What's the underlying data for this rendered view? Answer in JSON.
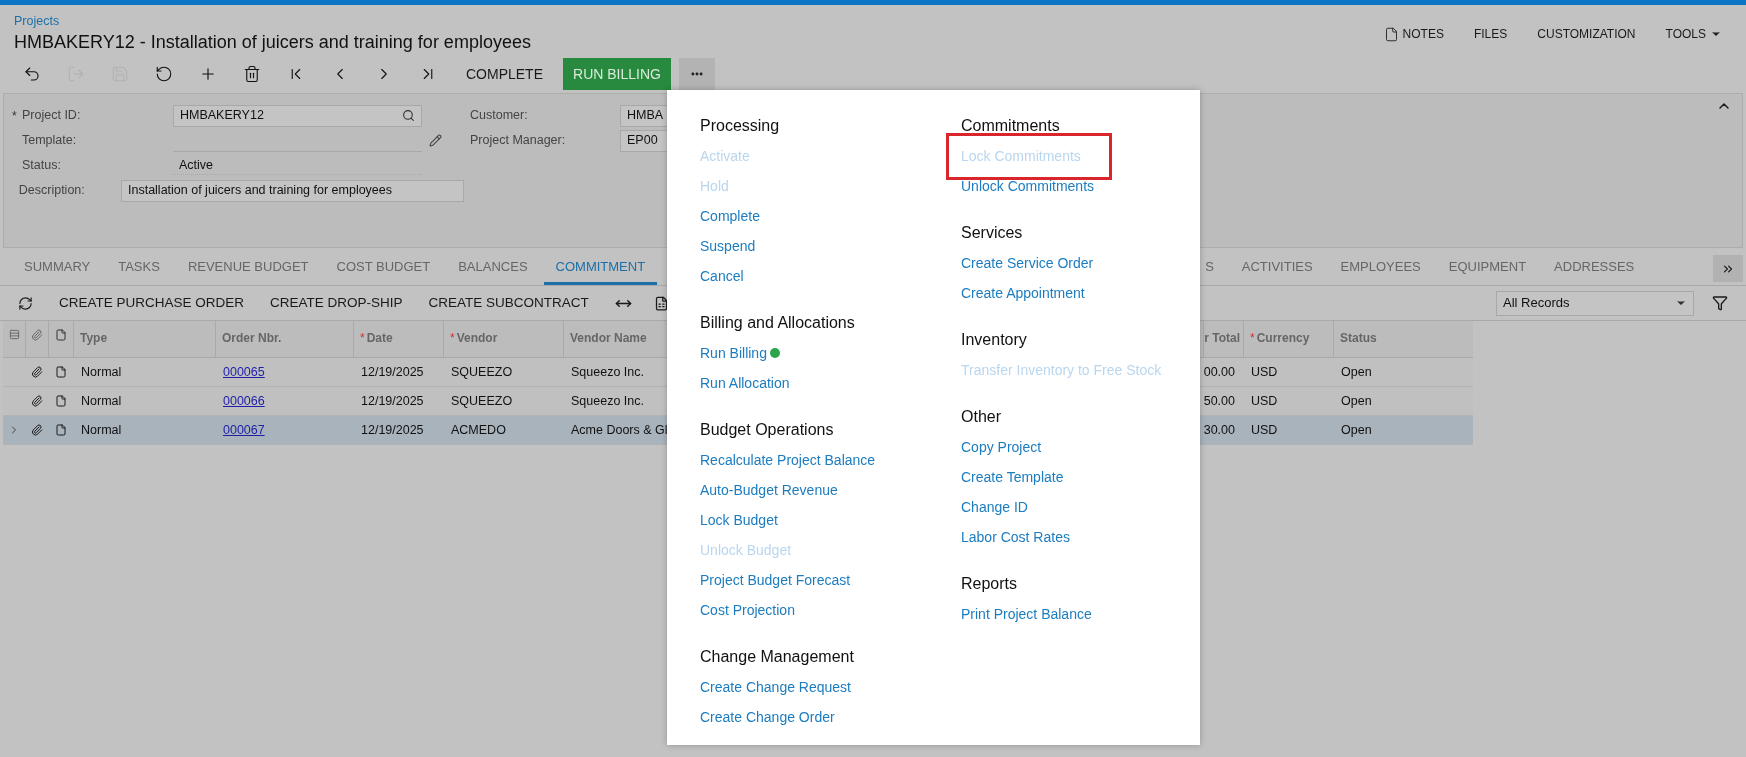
{
  "breadcrumb": "Projects",
  "title": "HMBAKERY12 - Installation of juicers and training for employees",
  "top_actions": [
    {
      "label": "NOTES",
      "kind": "notes"
    },
    {
      "label": "FILES",
      "kind": "plain"
    },
    {
      "label": "CUSTOMIZATION",
      "kind": "plain"
    },
    {
      "label": "TOOLS",
      "kind": "dropdown"
    }
  ],
  "icon_buttons": [
    {
      "kind": "back",
      "disabled": false
    },
    {
      "kind": "save-close",
      "disabled": true
    },
    {
      "kind": "save",
      "disabled": true
    },
    {
      "kind": "undo",
      "disabled": false
    },
    {
      "kind": "add",
      "disabled": false
    },
    {
      "kind": "delete",
      "disabled": false
    },
    {
      "kind": "first",
      "disabled": false
    },
    {
      "kind": "previous",
      "disabled": false
    },
    {
      "kind": "next",
      "disabled": false
    },
    {
      "kind": "last",
      "disabled": false
    }
  ],
  "action_buttons": [
    {
      "label": "COMPLETE",
      "kind": "plain"
    },
    {
      "label": "RUN BILLING",
      "kind": "primary"
    }
  ],
  "form": {
    "fields": [
      {
        "mark": "*",
        "label": "Project ID:",
        "value": "HMBAKERY12",
        "kind": "lookup"
      },
      {
        "label": "Template:",
        "kind": "editable"
      },
      {
        "label": "Status:",
        "value": "Active",
        "kind": "readonly"
      },
      {
        "label": "Description:",
        "value": "Installation of juicers and training for employees",
        "kind": "wide"
      }
    ],
    "side_fields": [
      {
        "label": "Customer:",
        "value": "HMBA"
      },
      {
        "label": "Project Manager:",
        "value": "EP00"
      }
    ]
  },
  "tabs": [
    {
      "label": "SUMMARY",
      "selected": false
    },
    {
      "label": "TASKS",
      "selected": false
    },
    {
      "label": "REVENUE BUDGET",
      "selected": false
    },
    {
      "label": "COST BUDGET",
      "selected": false
    },
    {
      "label": "BALANCES",
      "selected": false
    },
    {
      "label": "COMMITMENT",
      "selected": true
    }
  ],
  "tabs_right": [
    {
      "label": "S",
      "selected": false
    },
    {
      "label": "ACTIVITIES",
      "selected": false
    },
    {
      "label": "EMPLOYEES",
      "selected": false
    },
    {
      "label": "EQUIPMENT",
      "selected": false
    },
    {
      "label": "ADDRESSES",
      "selected": false
    }
  ],
  "grid": {
    "actions": [
      "CREATE PURCHASE ORDER",
      "CREATE DROP-SHIP",
      "CREATE SUBCONTRACT"
    ],
    "filter": {
      "value": "All Records"
    },
    "columns": [
      {
        "label": "Type"
      },
      {
        "label": "Order Nbr."
      },
      {
        "mark": "*",
        "label": "Date"
      },
      {
        "mark": "*",
        "label": "Vendor"
      },
      {
        "label": "Vendor Name"
      },
      {
        "label": "r Total"
      },
      {
        "mark": "*",
        "label": "Currency"
      },
      {
        "label": "Status"
      }
    ],
    "rows": [
      {
        "selected": false,
        "cells": [
          "Normal",
          "000065",
          "12/19/2025",
          "SQUEEZO",
          "Squeezo Inc.",
          "00.00",
          "USD",
          "Open"
        ]
      },
      {
        "selected": false,
        "cells": [
          "Normal",
          "000066",
          "12/19/2025",
          "SQUEEZO",
          "Squeezo Inc.",
          "50.00",
          "USD",
          "Open"
        ]
      },
      {
        "selected": true,
        "cells": [
          "Normal",
          "000067",
          "12/19/2025",
          "ACMEDO",
          "Acme Doors & Gl",
          "30.00",
          "USD",
          "Open"
        ]
      }
    ]
  },
  "menu": {
    "columns": [
      [
        {
          "heading": "Processing",
          "items": [
            {
              "label": "Activate",
              "disabled": true,
              "highlighted": false,
              "dot": false
            },
            {
              "label": "Hold",
              "disabled": true,
              "highlighted": false,
              "dot": false
            },
            {
              "label": "Complete",
              "disabled": false,
              "highlighted": false,
              "dot": false
            },
            {
              "label": "Suspend",
              "disabled": false,
              "highlighted": false,
              "dot": false
            },
            {
              "label": "Cancel",
              "disabled": false,
              "highlighted": false,
              "dot": false
            }
          ]
        },
        {
          "heading": "Billing and Allocations",
          "items": [
            {
              "label": "Run Billing",
              "disabled": false,
              "highlighted": false,
              "dot": true
            },
            {
              "label": "Run Allocation",
              "disabled": false,
              "highlighted": false,
              "dot": false
            }
          ]
        },
        {
          "heading": "Budget Operations",
          "items": [
            {
              "label": "Recalculate Project Balance",
              "disabled": false,
              "highlighted": false,
              "dot": false
            },
            {
              "label": "Auto-Budget Revenue",
              "disabled": false,
              "highlighted": false,
              "dot": false
            },
            {
              "label": "Lock Budget",
              "disabled": false,
              "highlighted": false,
              "dot": false
            },
            {
              "label": "Unlock Budget",
              "disabled": true,
              "highlighted": false,
              "dot": false
            },
            {
              "label": "Project Budget Forecast",
              "disabled": false,
              "highlighted": false,
              "dot": false
            },
            {
              "label": "Cost Projection",
              "disabled": false,
              "highlighted": false,
              "dot": false
            }
          ]
        },
        {
          "heading": "Change Management",
          "items": [
            {
              "label": "Create Change Request",
              "disabled": false,
              "highlighted": false,
              "dot": false
            },
            {
              "label": "Create Change Order",
              "disabled": false,
              "highlighted": false,
              "dot": false
            }
          ]
        }
      ],
      [
        {
          "heading": "Commitments",
          "items": [
            {
              "label": "Lock Commitments",
              "disabled": true,
              "highlighted": true,
              "dot": false
            },
            {
              "label": "Unlock Commitments",
              "disabled": false,
              "highlighted": false,
              "dot": false
            }
          ]
        },
        {
          "heading": "Services",
          "items": [
            {
              "label": "Create Service Order",
              "disabled": false,
              "highlighted": false,
              "dot": false
            },
            {
              "label": "Create Appointment",
              "disabled": false,
              "highlighted": false,
              "dot": false
            }
          ]
        },
        {
          "heading": "Inventory",
          "items": [
            {
              "label": "Transfer Inventory to Free Stock",
              "disabled": true,
              "highlighted": false,
              "dot": false
            }
          ]
        },
        {
          "heading": "Other",
          "items": [
            {
              "label": "Copy Project",
              "disabled": false,
              "highlighted": false,
              "dot": false
            },
            {
              "label": "Create Template",
              "disabled": false,
              "highlighted": false,
              "dot": false
            },
            {
              "label": "Change ID",
              "disabled": false,
              "highlighted": false,
              "dot": false
            },
            {
              "label": "Labor Cost Rates",
              "disabled": false,
              "highlighted": false,
              "dot": false
            }
          ]
        },
        {
          "heading": "Reports",
          "items": [
            {
              "label": "Print Project Balance",
              "disabled": false,
              "highlighted": false,
              "dot": false
            }
          ]
        }
      ]
    ]
  }
}
